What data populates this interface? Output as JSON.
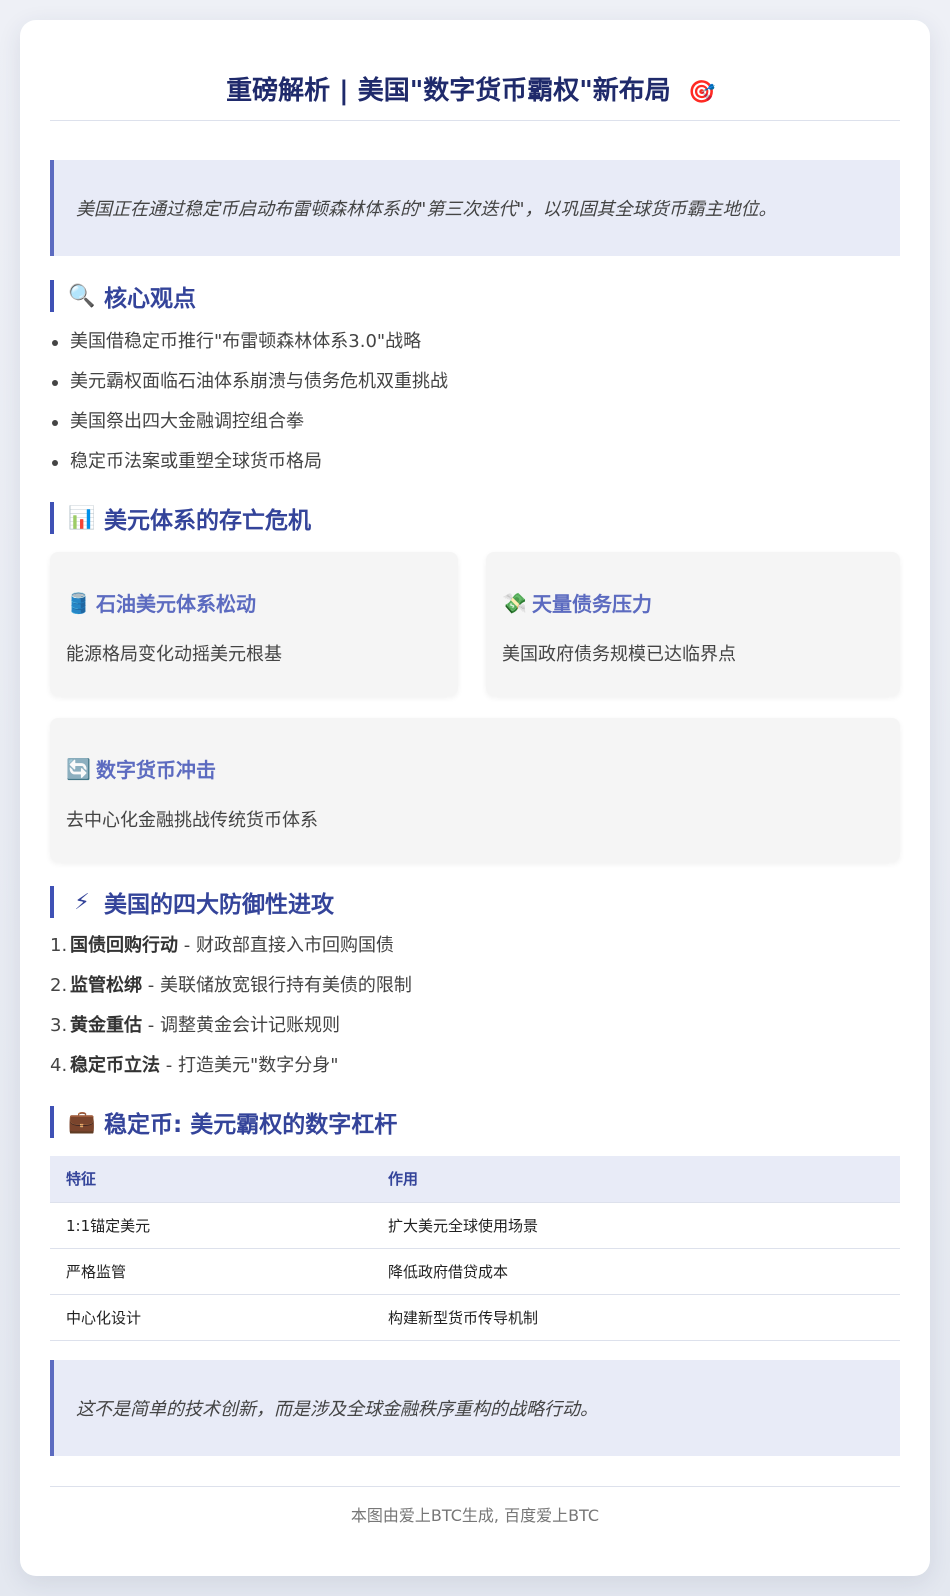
{
  "header": {
    "title": "重磅解析 | 美国\"数字货币霸权\"新布局",
    "title_icon": "🎯"
  },
  "intro": {
    "quote": "美国正在通过稳定币启动布雷顿森林体系的\"第三次迭代\"，以巩固其全球货币霸主地位。"
  },
  "core_views": {
    "icon": "🔍",
    "title": "核心观点",
    "items": [
      "美国借稳定币推行\"布雷顿森林体系3.0\"战略",
      "美元霸权面临石油体系崩溃与债务危机双重挑战",
      "美国祭出四大金融调控组合拳",
      "稳定币法案或重塑全球货币格局"
    ]
  },
  "crisis": {
    "icon": "📊",
    "title": "美元体系的存亡危机",
    "cards": [
      {
        "icon": "🛢️",
        "title": "石油美元体系松动",
        "desc": "能源格局变化动摇美元根基"
      },
      {
        "icon": "💸",
        "title": "天量债务压力",
        "desc": "美国政府债务规模已达临界点"
      },
      {
        "icon": "🔄",
        "title": "数字货币冲击",
        "desc": "去中心化金融挑战传统货币体系"
      }
    ]
  },
  "defense": {
    "icon": "⚡",
    "title": "美国的四大防御性进攻",
    "items": [
      {
        "num": "1.",
        "term": "国债回购行动",
        "desc": " - 财政部直接入市回购国债"
      },
      {
        "num": "2.",
        "term": "监管松绑",
        "desc": " - 美联储放宽银行持有美债的限制"
      },
      {
        "num": "3.",
        "term": "黄金重估",
        "desc": " - 调整黄金会计记账规则"
      },
      {
        "num": "4.",
        "term": "稳定币立法",
        "desc": " - 打造美元\"数字分身\""
      }
    ]
  },
  "stablecoin": {
    "icon": "💼",
    "title": "稳定币: 美元霸权的数字杠杆",
    "headers": [
      "特征",
      "作用"
    ],
    "rows": [
      [
        "1:1锚定美元",
        "扩大美元全球使用场景"
      ],
      [
        "严格监管",
        "降低政府借贷成本"
      ],
      [
        "中心化设计",
        "构建新型货币传导机制"
      ]
    ]
  },
  "conclusion": {
    "quote": "这不是简单的技术创新，而是涉及全球金融秩序重构的战略行动。"
  },
  "footer": {
    "text": "本图由爱上BTC生成, 百度爱上BTC"
  }
}
